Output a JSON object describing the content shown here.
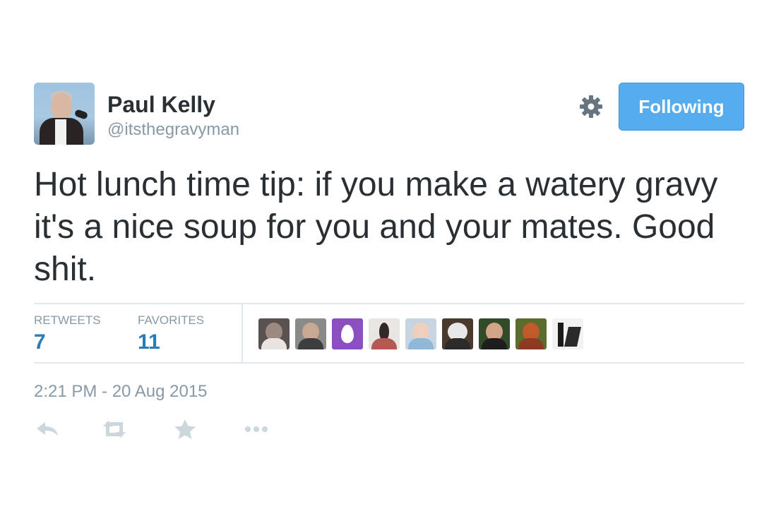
{
  "author": {
    "name": "Paul Kelly",
    "handle": "@itsthegravyman"
  },
  "follow_button": {
    "label": "Following",
    "color": "#55acee"
  },
  "tweet": {
    "text": "Hot lunch time tip: if you make a watery gravy it's a nice soup for you and your mates. Good shit.",
    "timestamp": "2:21 PM - 20 Aug 2015"
  },
  "stats": {
    "retweets": {
      "label": "RETWEETS",
      "value": "7"
    },
    "favorites": {
      "label": "FAVORITES",
      "value": "11"
    }
  },
  "favoriters": [
    {
      "icon": "user-avatar"
    },
    {
      "icon": "user-avatar"
    },
    {
      "icon": "egg-avatar",
      "color": "#8c4fbf"
    },
    {
      "icon": "user-avatar"
    },
    {
      "icon": "user-avatar"
    },
    {
      "icon": "cat-avatar"
    },
    {
      "icon": "user-avatar"
    },
    {
      "icon": "user-avatar"
    },
    {
      "icon": "user-avatar"
    }
  ],
  "actions": [
    "reply-icon",
    "retweet-icon",
    "favorite-icon",
    "more-icon"
  ],
  "colors": {
    "text": "#292f33",
    "muted": "#8899a6",
    "link_blue": "#2b7bb9",
    "divider": "#e1e8ed",
    "icon_gray": "#ccd6dd"
  }
}
